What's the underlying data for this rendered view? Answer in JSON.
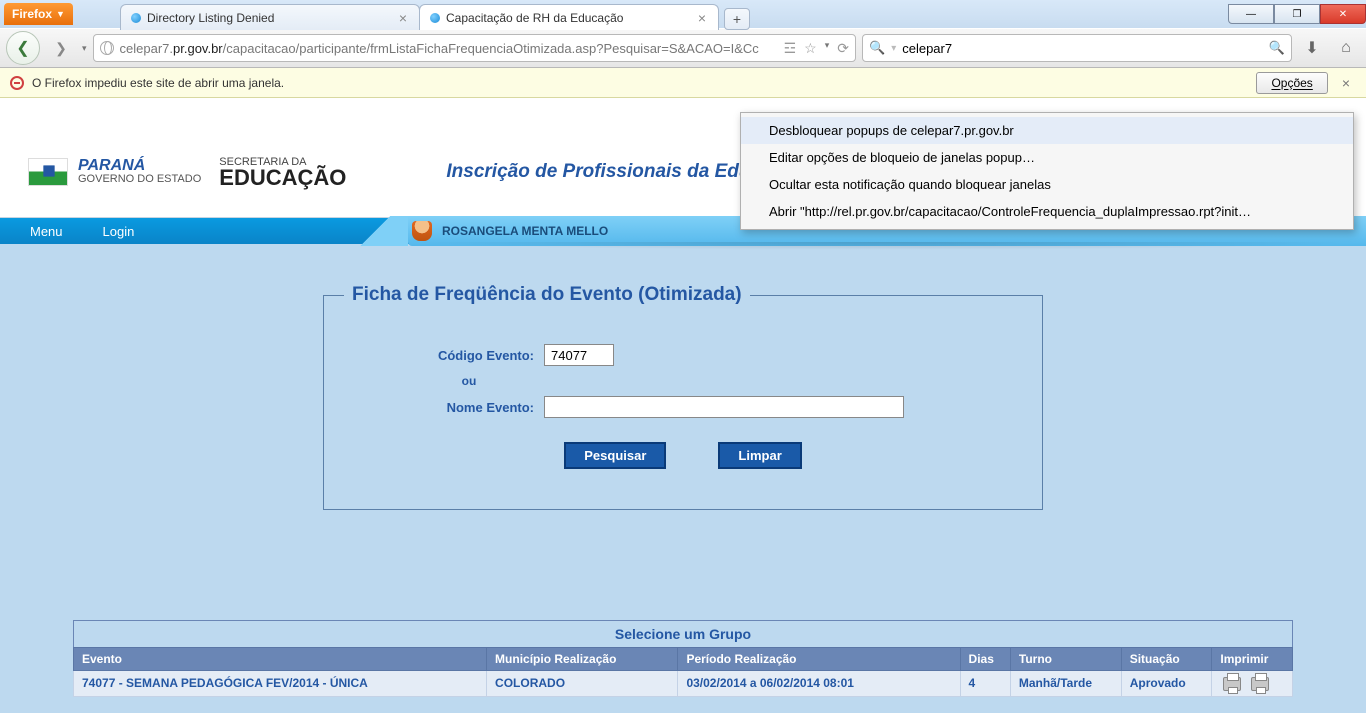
{
  "browser": {
    "menu_button": "Firefox",
    "tabs": [
      {
        "label": "Directory Listing Denied",
        "active": false
      },
      {
        "label": "Capacitação de RH da Educação",
        "active": true
      }
    ],
    "url_prefix": "celepar7.",
    "url_host": "pr.gov.br",
    "url_path": "/capacitacao/participante/frmListaFichaFrequenciaOtimizada.asp?Pesquisar=S&ACAO=I&Cc",
    "search_value": "celepar7"
  },
  "notification": {
    "text": "O Firefox impediu este site de abrir uma janela.",
    "options_btn": "Opções"
  },
  "options_menu": {
    "items": [
      "Desbloquear popups de celepar7.pr.gov.br",
      "Editar opções de bloqueio de janelas popup…",
      "Ocultar esta notificação quando bloquear janelas",
      "Abrir \"http://rel.pr.gov.br/capacitacao/ControleFrequencia_duplaImpressao.rpt?init…"
    ]
  },
  "page": {
    "brand_state": "PARANÁ",
    "brand_sub": "GOVERNO DO ESTADO",
    "secretaria_sup": "SECRETARIA DA",
    "secretaria": "EDUCAÇÃO",
    "title": "Inscrição de Profissionais da Educação",
    "nav_menu": "Menu",
    "nav_login": "Login",
    "user_name": "ROSANGELA MENTA MELLO"
  },
  "form": {
    "legend": "Ficha de Freqüência do Evento (Otimizada)",
    "label_codigo": "Código Evento:",
    "codigo_value": "74077",
    "ou": "ou",
    "label_nome": "Nome Evento:",
    "nome_value": "",
    "btn_pesquisar": "Pesquisar",
    "btn_limpar": "Limpar"
  },
  "group": {
    "title": "Selecione um Grupo",
    "headers": {
      "evento": "Evento",
      "municipio": "Município Realização",
      "periodo": "Período Realização",
      "dias": "Dias",
      "turno": "Turno",
      "situacao": "Situação",
      "imprimir": "Imprimir"
    },
    "row": {
      "evento": "74077 - SEMANA PEDAGÓGICA FEV/2014 - ÚNICA",
      "municipio": "COLORADO",
      "periodo": "03/02/2014 a 06/02/2014  08:01",
      "dias": "4",
      "turno": "Manhã/Tarde",
      "situacao": "Aprovado"
    }
  }
}
